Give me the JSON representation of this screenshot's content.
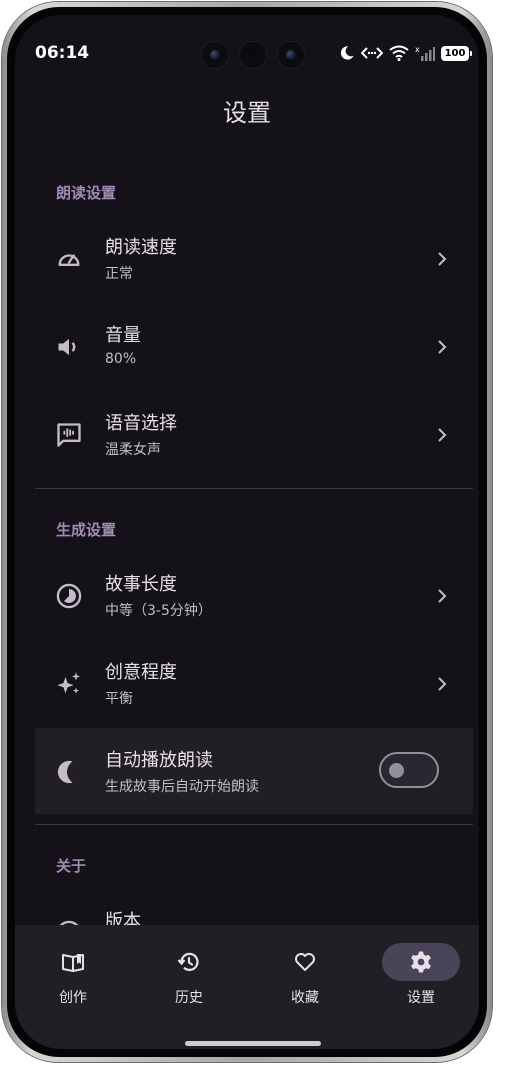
{
  "status_bar": {
    "time": "06:14",
    "battery": "100",
    "icons": [
      "moon-icon",
      "data-transfer-icon",
      "wifi-icon",
      "signal-icon",
      "battery-icon"
    ]
  },
  "page_title": "设置",
  "sections": {
    "reading": {
      "header": "朗读设置",
      "speed": {
        "title": "朗读速度",
        "value": "正常",
        "icon": "speedometer-icon"
      },
      "volume": {
        "title": "音量",
        "value": "80%",
        "icon": "volume-icon"
      },
      "voice": {
        "title": "语音选择",
        "value": "温柔女声",
        "icon": "voice-message-icon"
      }
    },
    "generation": {
      "header": "生成设置",
      "length": {
        "title": "故事长度",
        "value": "中等（3-5分钟）",
        "icon": "timelapse-icon"
      },
      "creativity": {
        "title": "创意程度",
        "value": "平衡",
        "icon": "sparkle-icon"
      },
      "autoplay": {
        "title": "自动播放朗读",
        "value": "生成故事后自动开始朗读",
        "icon": "moon-icon",
        "enabled": false
      }
    },
    "about": {
      "header": "关于",
      "version": {
        "title": "版本",
        "icon": "info-icon"
      }
    }
  },
  "bottom_nav": {
    "items": [
      {
        "label": "创作",
        "icon": "open-book-icon",
        "active": false
      },
      {
        "label": "历史",
        "icon": "history-icon",
        "active": false
      },
      {
        "label": "收藏",
        "icon": "heart-icon",
        "active": false
      },
      {
        "label": "设置",
        "icon": "gear-icon",
        "active": true
      }
    ]
  },
  "colors": {
    "background": "#141218",
    "section_header": "#a08cb4",
    "nav_background": "#211f26",
    "nav_active_pill": "#4a4458"
  }
}
